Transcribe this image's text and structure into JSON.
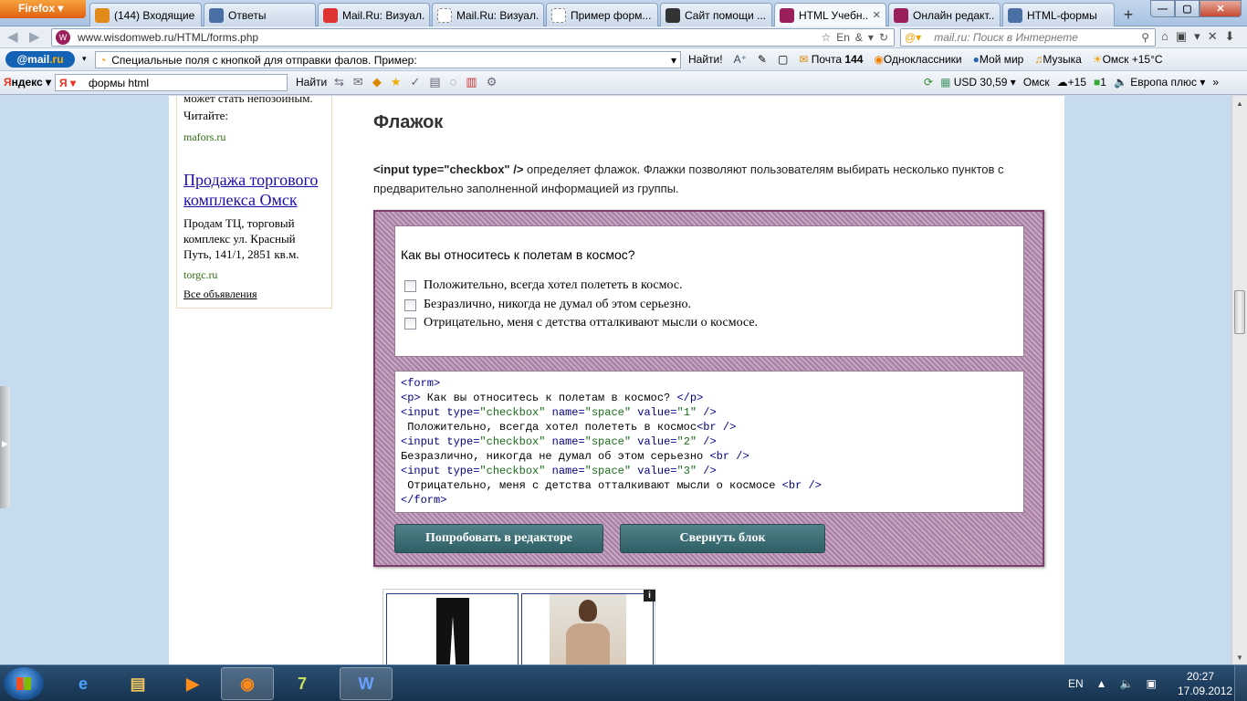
{
  "titlebar": {
    "app_button": "Firefox",
    "tabs": [
      {
        "label": "(144) Входящие ...",
        "icon": "mail-at-icon",
        "color": "#e38a1a"
      },
      {
        "label": "Ответы",
        "icon": "vk-icon",
        "color": "#4a6fa5"
      },
      {
        "label": "Mail.Ru: Визуал...",
        "icon": "yandex-ya-icon",
        "color": "#d33"
      },
      {
        "label": "Mail.Ru: Визуал...",
        "icon": "blank-page-icon",
        "color": "#ffffff"
      },
      {
        "label": "Пример форм...",
        "icon": "blank-page-icon",
        "color": "#ffffff"
      },
      {
        "label": "Сайт помощи ...",
        "icon": "film-icon",
        "color": "#333333"
      },
      {
        "label": "HTML Учебн...",
        "icon": "wisdomweb-icon",
        "color": "#9b1f5a",
        "active": true
      },
      {
        "label": "Онлайн редакт...",
        "icon": "wisdomweb-icon",
        "color": "#9b1f5a"
      },
      {
        "label": "HTML-формы",
        "icon": "vk-icon",
        "color": "#4a6fa5"
      }
    ],
    "new_tab": "+"
  },
  "navbar": {
    "url": "www.wisdomweb.ru/HTML/forms.php",
    "lang": "En",
    "search_placeholder": "mail.ru: Поиск в Интернете"
  },
  "mailbar": {
    "logo_prefix": "@mail",
    "logo_suffix": ".ru",
    "query": "Специальные поля с кнопкой для отправки фалов. Пример:",
    "find": "Найти!",
    "mail_label": "Почта",
    "mail_count": "144",
    "ok": "Одноклассники",
    "mymir": "Мой мир",
    "music": "Музыка",
    "weather": "Омск +15°С"
  },
  "yabar": {
    "logo_prefix": "Я",
    "logo_rest": "ндекс",
    "query": "формы html",
    "find": "Найти",
    "usd": "USD 30,59",
    "city": "Омск",
    "temp": "+15",
    "count": "1",
    "radio": "Европа плюс"
  },
  "ad": {
    "cut_text": "может стать непозойным.",
    "read": "Читайте:",
    "url1": "mafors.ru",
    "title": "Продажа торгового комплекса Омск",
    "text": "Продам ТЦ, торговый комплекс ул. Красный Путь, 141/1, 2851 кв.м.",
    "url2": "torgc.ru",
    "all": "Все объявления"
  },
  "content": {
    "heading": "Флажок",
    "intro_code": "<input type=\"checkbox\" />",
    "intro_text": " определяет флажок. Флажки позволяют пользователям выбирать несколько пунктов с предварительно заполненной информацией из группы.",
    "question": "Как вы относитесь к полетам в космос?",
    "options": [
      "Положительно, всегда хотел полететь в космос.",
      "Безразлично, никогда не думал об этом серьезно.",
      "Отрицательно, меня с детства отталкивают мысли о космосе."
    ],
    "btn_try": "Попробовать в редакторе",
    "btn_collapse": "Свернуть блок"
  },
  "code_lines": [
    [
      {
        "t": "<form>",
        "c": "tag"
      }
    ],
    [
      {
        "t": "<p>",
        "c": "tag"
      },
      {
        "t": " Как вы относитесь к полетам в космос? ",
        "c": ""
      },
      {
        "t": "</p>",
        "c": "tag"
      }
    ],
    [
      {
        "t": "<input type=",
        "c": "tag"
      },
      {
        "t": "\"checkbox\"",
        "c": "str"
      },
      {
        "t": " name=",
        "c": "tag"
      },
      {
        "t": "\"space\"",
        "c": "str"
      },
      {
        "t": " value=",
        "c": "tag"
      },
      {
        "t": "\"1\"",
        "c": "str"
      },
      {
        "t": " />",
        "c": "tag"
      }
    ],
    [
      {
        "t": " Положительно, всегда хотел полететь в космос",
        "c": ""
      },
      {
        "t": "<br />",
        "c": "tag"
      }
    ],
    [
      {
        "t": "<input type=",
        "c": "tag"
      },
      {
        "t": "\"checkbox\"",
        "c": "str"
      },
      {
        "t": " name=",
        "c": "tag"
      },
      {
        "t": "\"space\"",
        "c": "str"
      },
      {
        "t": " value=",
        "c": "tag"
      },
      {
        "t": "\"2\"",
        "c": "str"
      },
      {
        "t": " />",
        "c": "tag"
      }
    ],
    [
      {
        "t": "Безразлично, никогда не думал об этом серьезно ",
        "c": ""
      },
      {
        "t": "<br />",
        "c": "tag"
      }
    ],
    [
      {
        "t": "<input type=",
        "c": "tag"
      },
      {
        "t": "\"checkbox\"",
        "c": "str"
      },
      {
        "t": " name=",
        "c": "tag"
      },
      {
        "t": "\"space\"",
        "c": "str"
      },
      {
        "t": " value=",
        "c": "tag"
      },
      {
        "t": "\"3\"",
        "c": "str"
      },
      {
        "t": " />",
        "c": "tag"
      }
    ],
    [
      {
        "t": " Отрицательно, меня с детства отталкивают мысли о космосе ",
        "c": ""
      },
      {
        "t": "<br />",
        "c": "tag"
      }
    ],
    [
      {
        "t": "</form>",
        "c": "tag"
      }
    ]
  ],
  "products": {
    "badge": "i"
  },
  "taskbar": {
    "apps": [
      "internet-explorer-icon",
      "explorer-folder-icon",
      "media-player-icon",
      "firefox-icon",
      "7zip-icon",
      "word-icon"
    ],
    "lang": "EN",
    "time": "20:27",
    "date": "17.09.2012"
  }
}
